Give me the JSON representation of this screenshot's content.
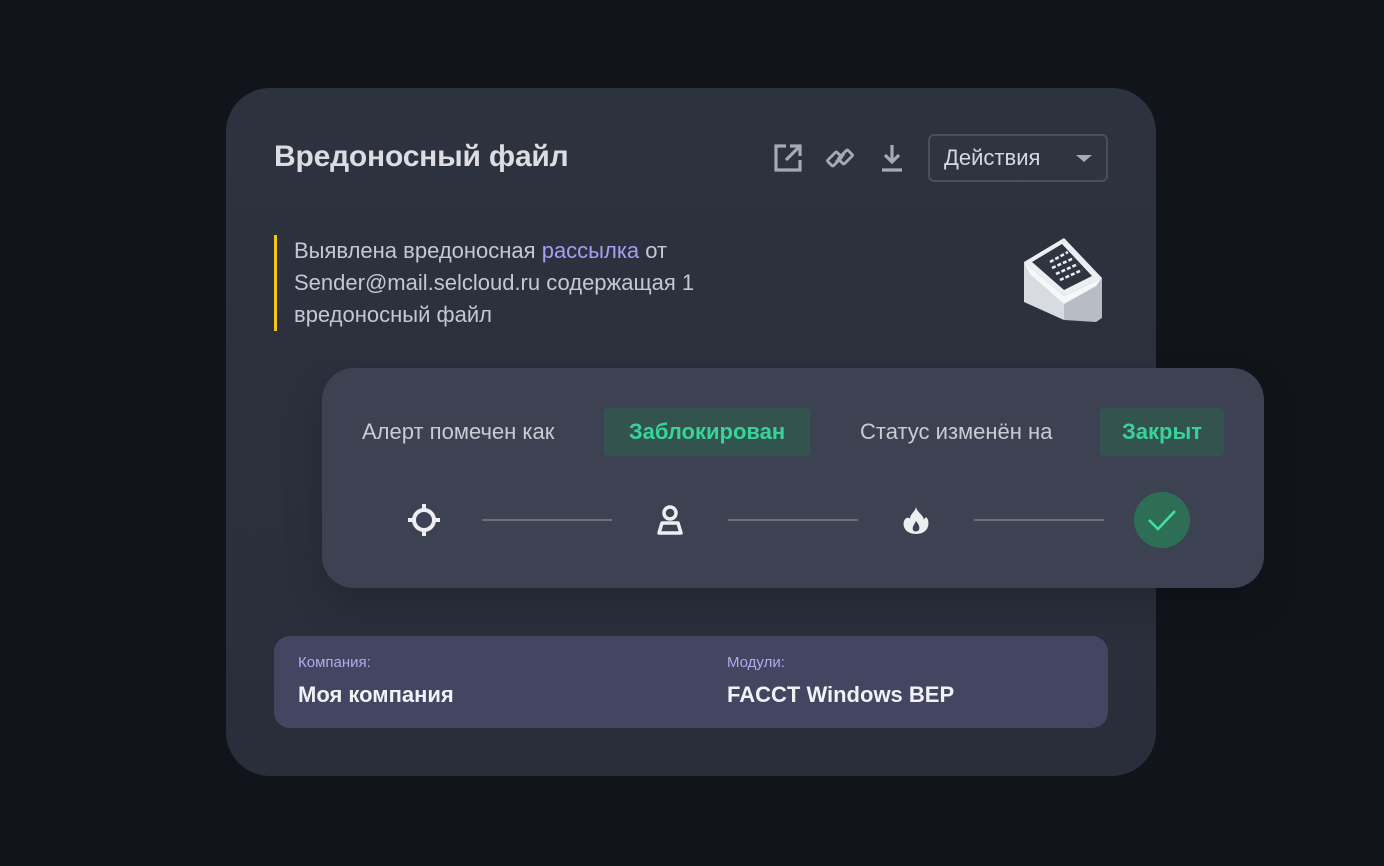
{
  "card": {
    "title": "Вредоносный файл",
    "toolbar": {
      "open_icon": "external-link-icon",
      "link_icon": "link-icon",
      "download_icon": "download-icon",
      "actions_label": "Действия",
      "actions_icon": "chevron-down-icon"
    },
    "description": {
      "part1": "Выявлена вредоносная ",
      "link_text": "рассылка",
      "part2": " от Sender@mail.selcloud.ru содержащая 1 вредоносный файл",
      "accent_color": "#f5c518"
    },
    "illustration_icon": "envelope-icon"
  },
  "status_panel": {
    "marked_as_text": "Алерт помечен как",
    "marked_as_badge": "Заблокирован",
    "status_changed_text": "Статус изменён на",
    "status_badge": "Закрыт",
    "badge_color": "#37d39a",
    "steps": [
      {
        "icon": "crosshair-icon"
      },
      {
        "icon": "user-icon"
      },
      {
        "icon": "fire-icon"
      },
      {
        "icon": "check-icon",
        "state": "done"
      }
    ]
  },
  "info": {
    "company_label": "Компания:",
    "company_value": "Моя компания",
    "modules_label": "Модули:",
    "modules_value": "FACCT Windows BEP"
  }
}
